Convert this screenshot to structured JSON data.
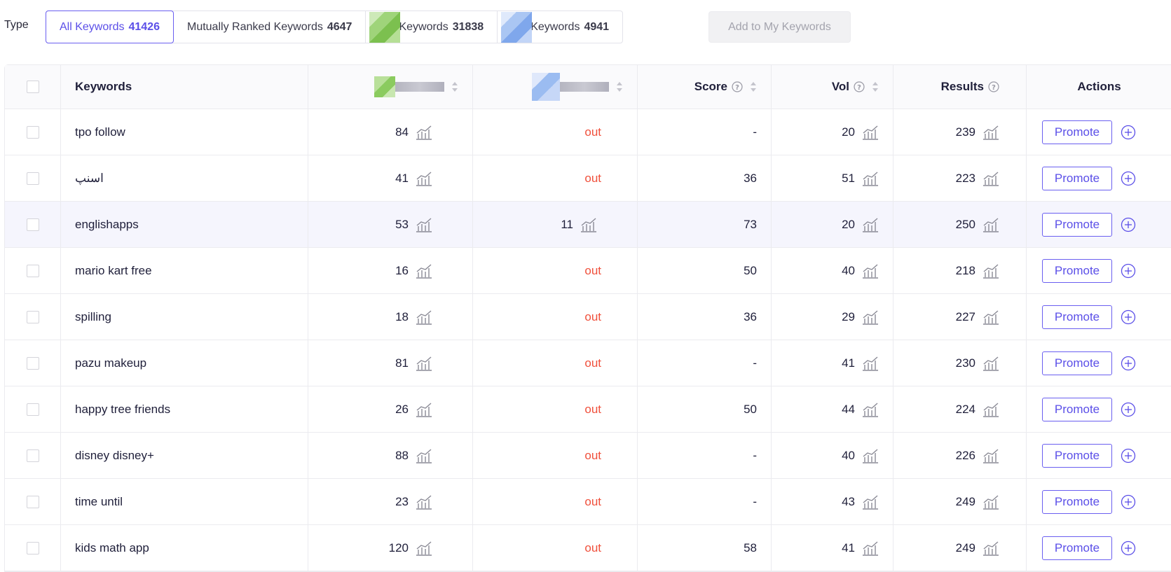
{
  "type_label": "Type",
  "tabs": [
    {
      "label": "All Keywords",
      "count": "41426",
      "active": true
    },
    {
      "label": "Mutually Ranked Keywords",
      "count": "4647"
    },
    {
      "label": "Keywords",
      "count": "31838",
      "thumb": "green"
    },
    {
      "label": "Keywords",
      "count": "4941",
      "thumb": "blue"
    }
  ],
  "add_button": "Add to My Keywords",
  "columns": {
    "keywords": "Keywords",
    "score": "Score",
    "vol": "Vol",
    "results": "Results",
    "actions": "Actions"
  },
  "promote_label": "Promote",
  "rows": [
    {
      "keyword": "tpo follow",
      "rank_a": "84",
      "rank_b": "out",
      "score": "-",
      "vol": "20",
      "results": "239"
    },
    {
      "keyword": "اسنپ",
      "rank_a": "41",
      "rank_b": "out",
      "score": "36",
      "vol": "51",
      "results": "223"
    },
    {
      "keyword": "englishapps",
      "rank_a": "53",
      "rank_b": "11",
      "score": "73",
      "vol": "20",
      "results": "250"
    },
    {
      "keyword": "mario kart free",
      "rank_a": "16",
      "rank_b": "out",
      "score": "50",
      "vol": "40",
      "results": "218"
    },
    {
      "keyword": "spilling",
      "rank_a": "18",
      "rank_b": "out",
      "score": "36",
      "vol": "29",
      "results": "227"
    },
    {
      "keyword": "pazu makeup",
      "rank_a": "81",
      "rank_b": "out",
      "score": "-",
      "vol": "41",
      "results": "230"
    },
    {
      "keyword": "happy tree friends",
      "rank_a": "26",
      "rank_b": "out",
      "score": "50",
      "vol": "44",
      "results": "224"
    },
    {
      "keyword": "disney disney+",
      "rank_a": "88",
      "rank_b": "out",
      "score": "-",
      "vol": "40",
      "results": "226"
    },
    {
      "keyword": "time until",
      "rank_a": "23",
      "rank_b": "out",
      "score": "-",
      "vol": "43",
      "results": "249"
    },
    {
      "keyword": "kids math app",
      "rank_a": "120",
      "rank_b": "out",
      "score": "58",
      "vol": "41",
      "results": "249"
    }
  ],
  "colors": {
    "accent": "#5b4fe8",
    "out": "#f0503c"
  }
}
